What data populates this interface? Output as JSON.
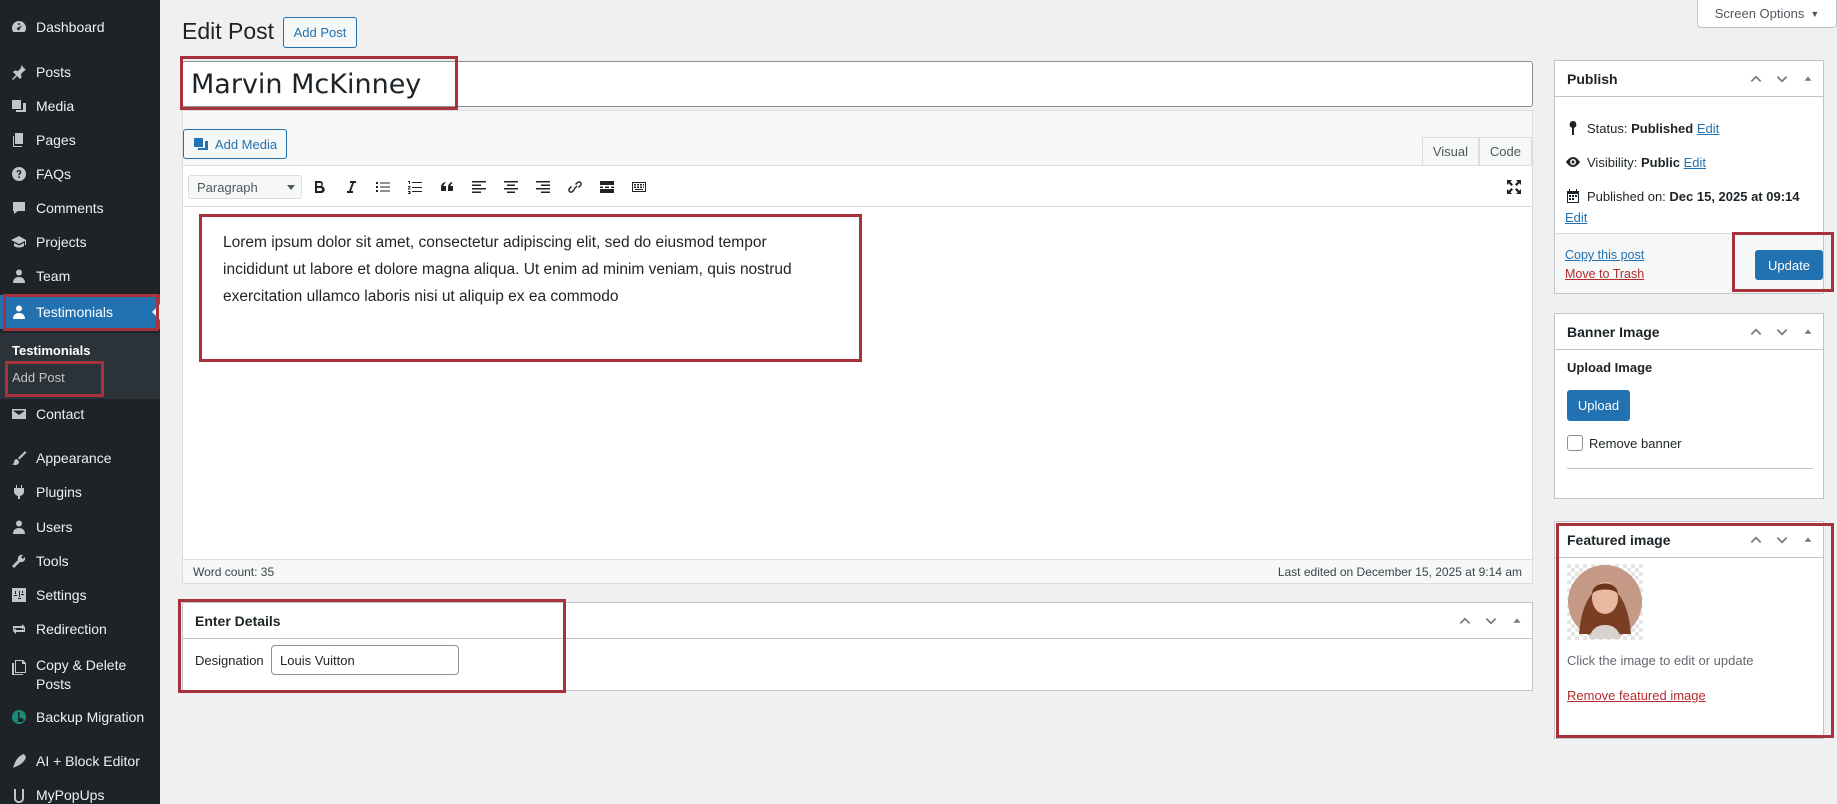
{
  "sidebar": {
    "items": [
      {
        "label": "Dashboard",
        "icon": "dashboard-icon"
      },
      {
        "label": "Posts",
        "icon": "pin-icon"
      },
      {
        "label": "Media",
        "icon": "media-icon"
      },
      {
        "label": "Pages",
        "icon": "pages-icon"
      },
      {
        "label": "FAQs",
        "icon": "help-icon"
      },
      {
        "label": "Comments",
        "icon": "comment-icon"
      },
      {
        "label": "Projects",
        "icon": "graduation-cap-icon"
      },
      {
        "label": "Team",
        "icon": "user-icon"
      },
      {
        "label": "Testimonials",
        "icon": "user-icon"
      },
      {
        "label": "Contact",
        "icon": "mail-icon"
      },
      {
        "label": "Appearance",
        "icon": "brush-icon"
      },
      {
        "label": "Plugins",
        "icon": "plugin-icon"
      },
      {
        "label": "Users",
        "icon": "users-icon"
      },
      {
        "label": "Tools",
        "icon": "wrench-icon"
      },
      {
        "label": "Settings",
        "icon": "settings-icon"
      },
      {
        "label": "Redirection",
        "icon": "redirect-icon"
      },
      {
        "label": "Copy & Delete Posts",
        "icon": "copy-icon"
      },
      {
        "label": "Backup Migration",
        "icon": "backup-icon"
      },
      {
        "label": "AI + Block Editor",
        "icon": "pen-icon"
      },
      {
        "label": "MyPopUps",
        "icon": "popup-icon"
      }
    ],
    "submenu": {
      "current": "Testimonials",
      "add": "Add Post"
    }
  },
  "header": {
    "title": "Edit Post",
    "add_button": "Add Post",
    "screen_options": "Screen Options"
  },
  "post": {
    "title": "Marvin McKinney",
    "content": "Lorem ipsum dolor sit amet, consectetur adipiscing elit, sed do eiusmod tempor incididunt ut labore et dolore magna aliqua. Ut enim ad minim veniam, quis nostrud exercitation ullamco laboris nisi ut aliquip ex ea commodo"
  },
  "editor": {
    "add_media": "Add Media",
    "tab_visual": "Visual",
    "tab_code": "Code",
    "format": "Paragraph",
    "word_count": "Word count: 35",
    "last_edited": "Last edited on December 15, 2025 at 9:14 am"
  },
  "details": {
    "title": "Enter Details",
    "designation_label": "Designation",
    "designation_value": "Louis Vuitton"
  },
  "publish": {
    "title": "Publish",
    "status_label": "Status:",
    "status_value": "Published",
    "visibility_label": "Visibility:",
    "visibility_value": "Public",
    "published_label": "Published on:",
    "published_value": "Dec 15, 2025 at 09:14",
    "edit": "Edit",
    "copy": "Copy this post",
    "trash": "Move to Trash",
    "update": "Update"
  },
  "banner": {
    "title": "Banner Image",
    "upload_heading": "Upload Image",
    "upload_button": "Upload",
    "remove_label": "Remove banner"
  },
  "featured": {
    "title": "Featured image",
    "hint": "Click the image to edit or update",
    "remove": "Remove featured image"
  },
  "colors": {
    "sidebar_bg": "#1d2327",
    "accent": "#2271b1",
    "annotation": "#a8323b"
  }
}
